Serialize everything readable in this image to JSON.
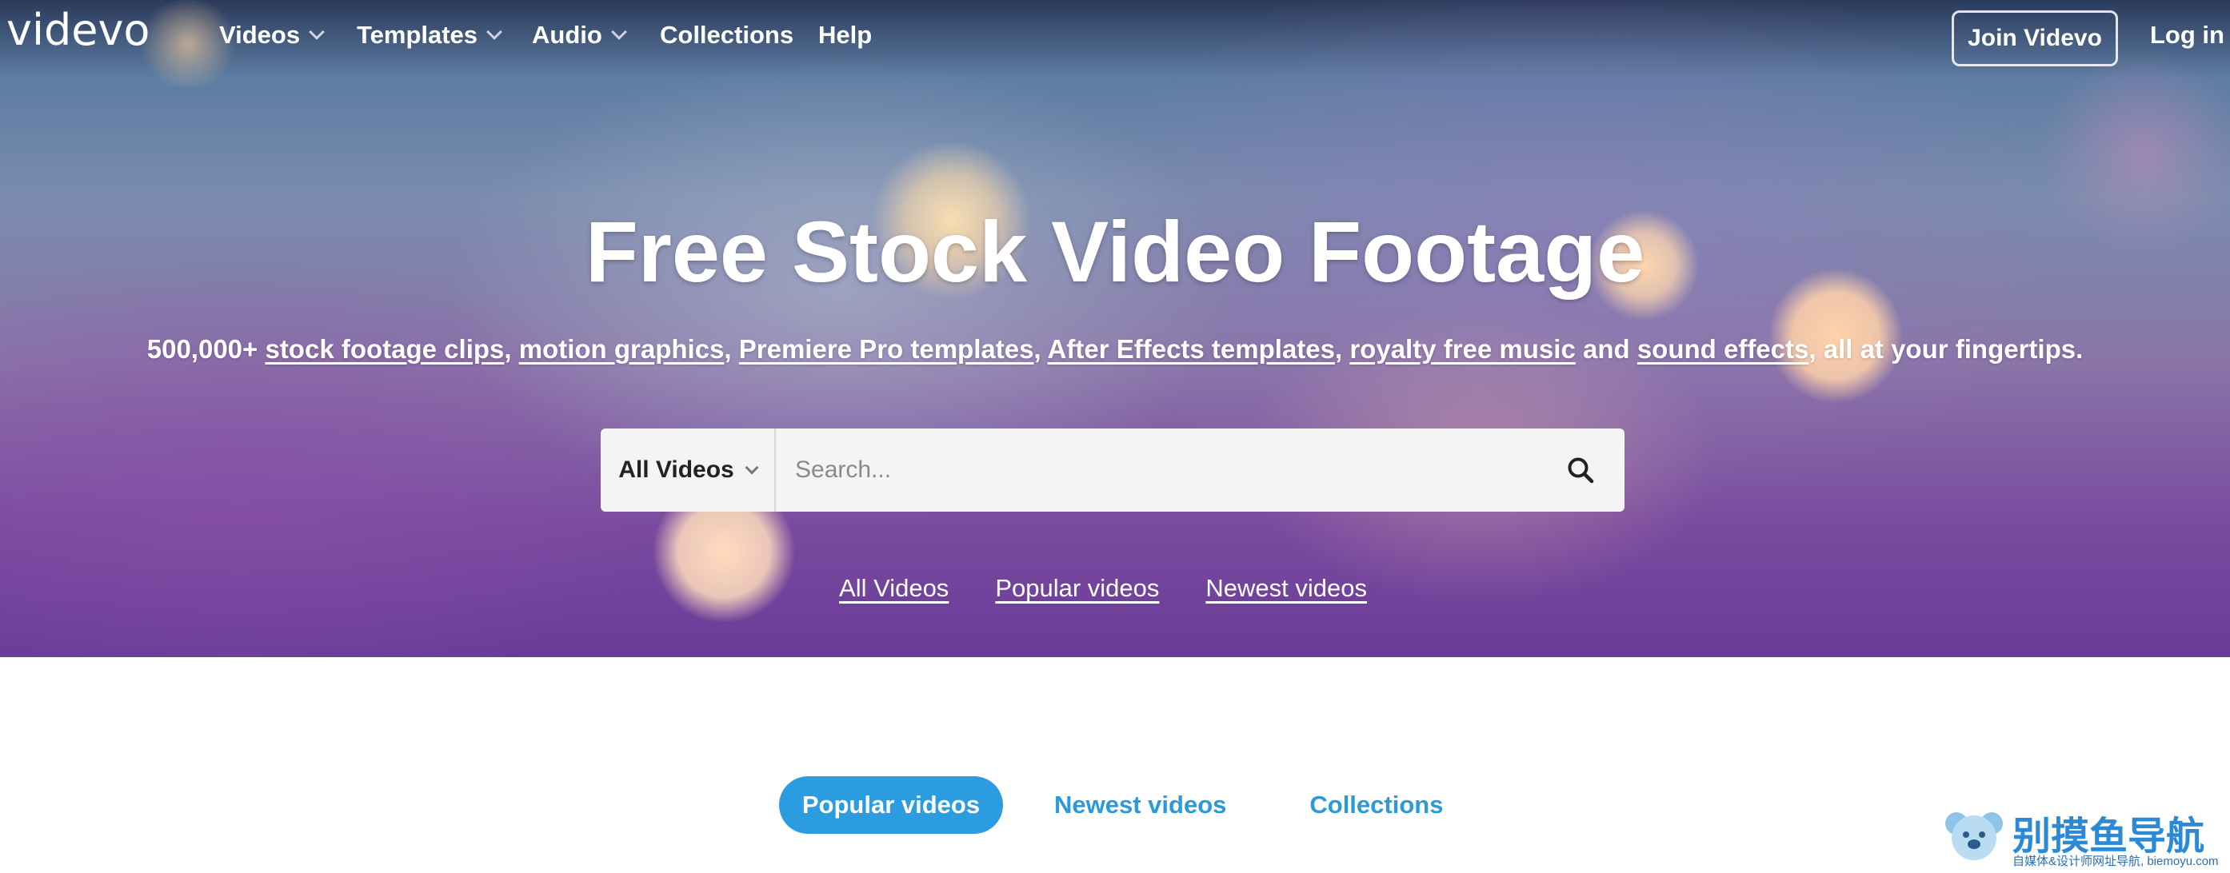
{
  "nav": {
    "logo": "videvo",
    "items": [
      {
        "label": "Videos",
        "dropdown": true
      },
      {
        "label": "Templates",
        "dropdown": true
      },
      {
        "label": "Audio",
        "dropdown": true
      },
      {
        "label": "Collections",
        "dropdown": false
      },
      {
        "label": "Help",
        "dropdown": false
      }
    ],
    "join_label": "Join Videvo",
    "login_label": "Log in"
  },
  "hero": {
    "title": "Free Stock Video Footage",
    "subtitle": {
      "prefix": "500,000+ ",
      "link1": "stock footage clips",
      "sep1": ", ",
      "link2": "motion graphics",
      "sep2": ", ",
      "link3": "Premiere Pro templates",
      "sep3": ", ",
      "link4": "After Effects templates",
      "sep4": ", ",
      "link5": "royalty free music",
      "mid": " and ",
      "link6": "sound effects",
      "suffix": ", all at your fingertips."
    },
    "search": {
      "category": "All Videos",
      "placeholder": "Search..."
    },
    "quick_links": [
      "All Videos",
      "Popular videos",
      "Newest videos"
    ]
  },
  "tabs": {
    "items": [
      "Popular videos",
      "Newest videos",
      "Collections"
    ],
    "active": "Popular videos"
  },
  "watermark": {
    "text": "别摸鱼导航",
    "small": "自媒体&设计师网址导航, biemoyu.com"
  },
  "colors": {
    "accent": "#2c9ce0",
    "tab_text": "#2b9ad8",
    "search_bg": "#f4f4f4"
  }
}
